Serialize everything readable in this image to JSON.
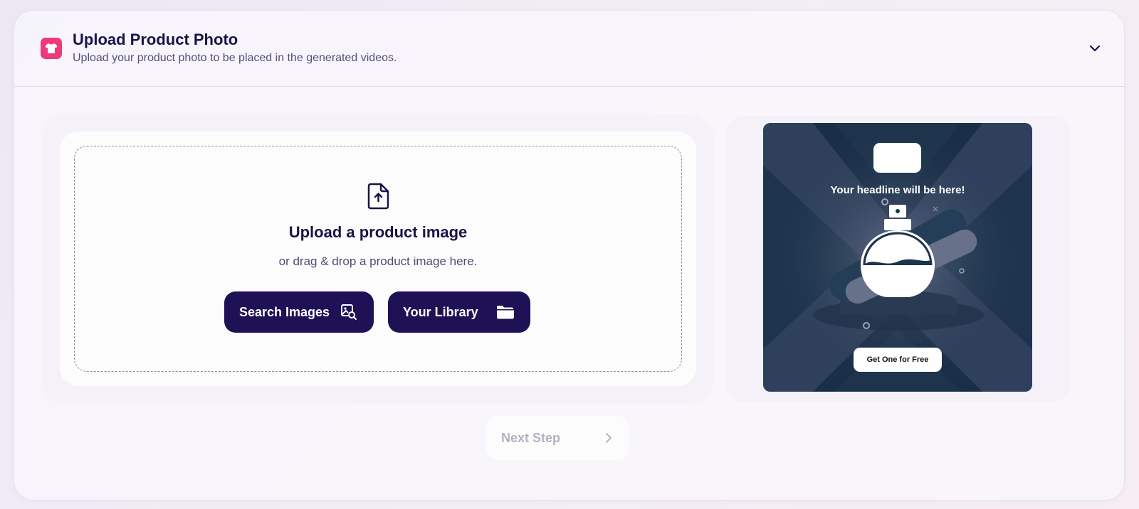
{
  "header": {
    "title": "Upload Product Photo",
    "subtitle": "Upload your product photo to be placed in the generated videos.",
    "icon": "tshirt-icon",
    "toggle_icon": "chevron-down-icon"
  },
  "upload": {
    "icon": "file-upload-icon",
    "title": "Upload a product image",
    "subtitle": "or drag & drop a product image here.",
    "search_button": {
      "label": "Search Images",
      "icon": "image-search-icon"
    },
    "library_button": {
      "label": "Your Library",
      "icon": "folder-icon"
    }
  },
  "preview": {
    "headline": "Your headline will be here!",
    "cta": "Get One for Free",
    "product_icon": "perfume-bottle-icon"
  },
  "footer": {
    "next_label": "Next Step",
    "next_icon": "chevron-right-icon"
  },
  "colors": {
    "accent_pink": "#ee3a79",
    "primary_navy": "#1e1155",
    "preview_bg": "#1d344c"
  }
}
